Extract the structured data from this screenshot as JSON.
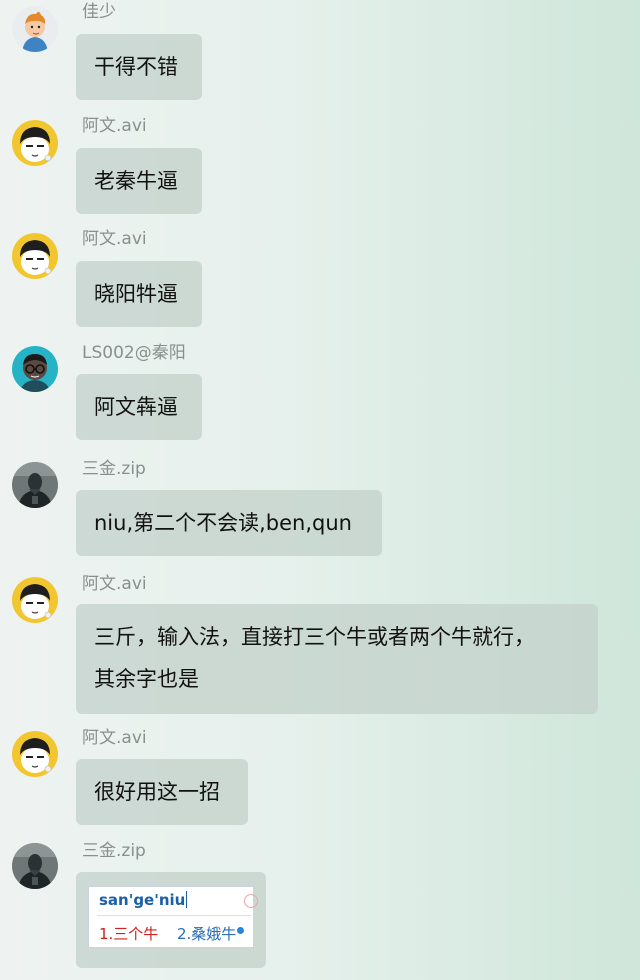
{
  "messages": [
    {
      "sender": "佳少",
      "text": "干得不错",
      "avatar": "cartoon-boy-avatar"
    },
    {
      "sender": "阿文.avi",
      "text": "老秦牛逼",
      "avatar": "cartoon-face-avatar"
    },
    {
      "sender": "阿文.avi",
      "text": "晓阳牪逼",
      "avatar": "cartoon-face-avatar"
    },
    {
      "sender": "LS002@秦阳",
      "text": "阿文犇逼",
      "avatar": "glasses-man-avatar"
    },
    {
      "sender": "三金.zip",
      "text": "niu,第二个不会读,ben,qun",
      "avatar": "dark-hero-avatar"
    },
    {
      "sender": "阿文.avi",
      "lines": [
        "三斤，输入法，直接打三个牛或者两个牛就行，",
        "其余字也是"
      ],
      "avatar": "cartoon-face-avatar"
    },
    {
      "sender": "阿文.avi",
      "text": "很好用这一招",
      "avatar": "cartoon-face-avatar"
    },
    {
      "sender": "三金.zip",
      "avatar": "dark-hero-avatar",
      "image": {
        "ime_input": "san'ge'niu",
        "candidate_1": "1.三个牛",
        "candidate_2": "2.桑娥牛"
      }
    }
  ],
  "colors": {
    "bubble": "#c4d2cc",
    "sender_name": "#8a8f8d",
    "ime_input": "#1b5fa9",
    "ime_candidate_1": "#d0201a",
    "ime_candidate_2": "#2a6fb8"
  }
}
